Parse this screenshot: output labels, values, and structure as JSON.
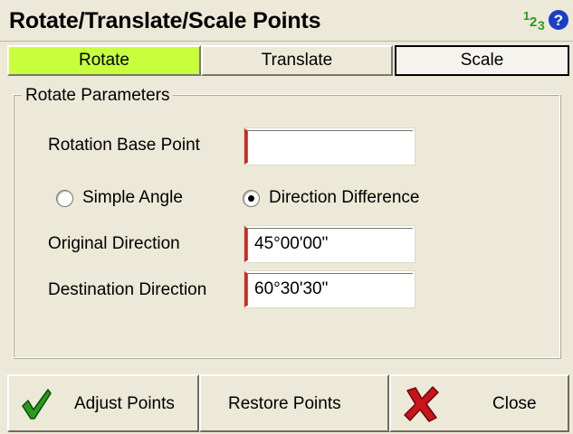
{
  "window": {
    "title": "Rotate/Translate/Scale Points",
    "icons": {
      "number_format": "numbers-123-icon",
      "help": "help-icon"
    },
    "number_icon_text": {
      "one": "1",
      "two": "2",
      "three": "3"
    },
    "help_icon_text": "?"
  },
  "tabs": [
    {
      "label": "Rotate",
      "active": true
    },
    {
      "label": "Translate",
      "active": false
    },
    {
      "label": "Scale",
      "active": false
    }
  ],
  "rotate_parameters": {
    "group_label": "Rotate Parameters",
    "base_point": {
      "label": "Rotation Base Point",
      "value": ""
    },
    "mode_options": [
      {
        "label": "Simple Angle",
        "checked": false
      },
      {
        "label": "Direction Difference",
        "checked": true
      }
    ],
    "original_direction": {
      "label": "Original Direction",
      "value": "45°00'00\""
    },
    "destination_direction": {
      "label": "Destination Direction",
      "value": "60°30'30\""
    }
  },
  "buttons": {
    "adjust": {
      "label": "Adjust Points",
      "icon": "checkmark-icon"
    },
    "restore": {
      "label": "Restore Points"
    },
    "close": {
      "label": "Close",
      "icon": "red-x-icon"
    }
  },
  "colors": {
    "background": "#ece9d8",
    "active_tab": "#c8ff3c",
    "field_accent": "#e0201c",
    "check_green": "#2a9a1a",
    "close_red": "#c8141a",
    "help_blue": "#1a3fc4"
  }
}
